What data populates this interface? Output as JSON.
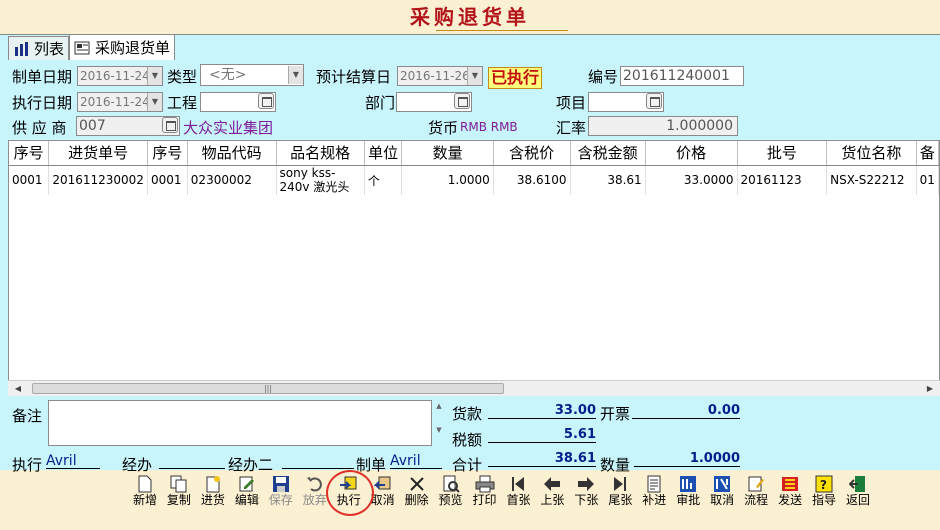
{
  "window": {
    "title": "采购退货单"
  },
  "tabs": [
    {
      "label": "列表"
    },
    {
      "label": "采购退货单"
    }
  ],
  "header": {
    "make_date_label": "制单日期",
    "make_date": "2016-11-24",
    "type_label": "类型",
    "type_value": "<无>",
    "settle_date_label": "预计结算日",
    "settle_date": "2016-11-26",
    "status": "已执行",
    "number_label": "编号",
    "number": "201611240001",
    "exec_date_label": "执行日期",
    "exec_date": "2016-11-24",
    "project_label": "工程",
    "project": "",
    "dept_label": "部门",
    "dept": "",
    "item_label": "项目",
    "item": "",
    "supplier_label": "供 应 商",
    "supplier_code": "007",
    "supplier_name": "大众实业集团",
    "currency_label": "货币",
    "currency_value": "RMB RMB",
    "rate_label": "汇率",
    "rate": "1.000000"
  },
  "table": {
    "columns": [
      "序号",
      "进货单号",
      "序号",
      "物品代码",
      "品名规格",
      "单位",
      "数量",
      "含税价",
      "含税金额",
      "价格",
      "批号",
      "货位名称",
      "备"
    ],
    "rows": [
      {
        "seq": "0001",
        "order_no": "201611230002",
        "seq2": "0001",
        "item_code": "02300002",
        "spec": "sony kss-240v 激光头",
        "unit": "个",
        "qty": "1.0000",
        "tax_price": "38.6100",
        "tax_amount": "38.61",
        "price": "33.0000",
        "batch": "20161123",
        "location": "NSX-S22212",
        "extra": "01"
      }
    ]
  },
  "footer": {
    "memo_label": "备注",
    "memo": "",
    "goods_label": "货款",
    "goods_amount": "33.00",
    "invoice_label": "开票",
    "invoice_amount": "0.00",
    "tax_label": "税额",
    "tax_amount": "5.61",
    "executor_label": "执行",
    "executor": "Avril",
    "handler_label": "经办",
    "handler": "",
    "handler2_label": "经办二",
    "handler2": "",
    "maker_label": "制单",
    "maker": "Avril",
    "total_label": "合计",
    "total": "38.61",
    "qty_label": "数量",
    "qty_total": "1.0000"
  },
  "toolbar": [
    {
      "label": "新增",
      "icon": "new-icon"
    },
    {
      "label": "复制",
      "icon": "copy-icon"
    },
    {
      "label": "进货",
      "icon": "stock-in-icon"
    },
    {
      "label": "编辑",
      "icon": "edit-icon"
    },
    {
      "label": "保存",
      "icon": "save-icon",
      "disabled": true
    },
    {
      "label": "放弃",
      "icon": "undo-icon",
      "disabled": true
    },
    {
      "label": "执行",
      "icon": "execute-icon"
    },
    {
      "label": "取消",
      "icon": "cancel-exec-icon"
    },
    {
      "label": "删除",
      "icon": "delete-icon"
    },
    {
      "label": "预览",
      "icon": "preview-icon"
    },
    {
      "label": "打印",
      "icon": "print-icon"
    },
    {
      "label": "首张",
      "icon": "first-icon"
    },
    {
      "label": "上张",
      "icon": "prev-icon"
    },
    {
      "label": "下张",
      "icon": "next-icon"
    },
    {
      "label": "尾张",
      "icon": "last-icon"
    },
    {
      "label": "补进",
      "icon": "supplement-icon"
    },
    {
      "label": "审批",
      "icon": "approve-icon"
    },
    {
      "label": "取消",
      "icon": "cancel-approve-icon"
    },
    {
      "label": "流程",
      "icon": "flow-icon"
    },
    {
      "label": "发送",
      "icon": "send-icon"
    },
    {
      "label": "指导",
      "icon": "help-icon"
    },
    {
      "label": "返回",
      "icon": "return-icon"
    }
  ],
  "colors": {
    "background": "#fbf0d2",
    "panel": "#c8f4fb",
    "title": "#b3141a",
    "accent_purple": "#7f1b9c",
    "value_blue": "#001f8a",
    "highlight": "#e0302a"
  }
}
